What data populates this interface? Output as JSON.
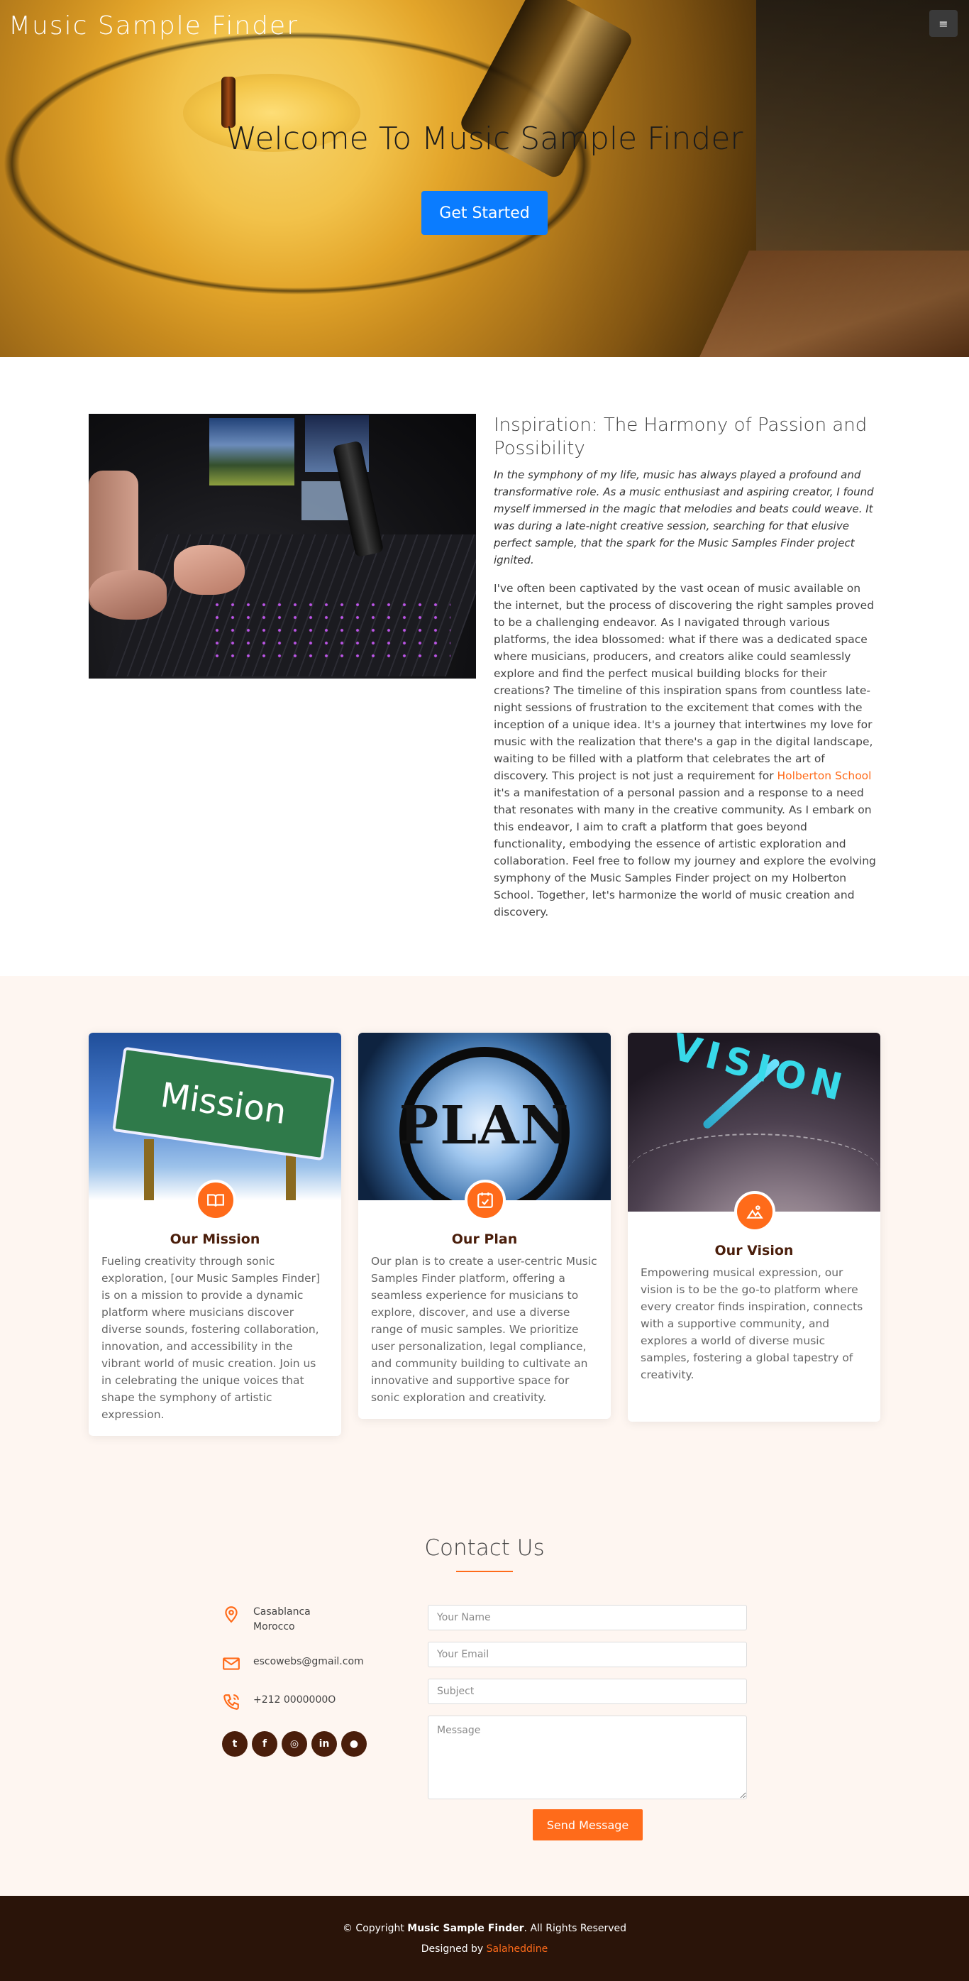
{
  "header": {
    "site_title": "Music Sample Finder",
    "menu_icon": "menu-icon"
  },
  "hero": {
    "heading": "Welcome To Music Sample Finder",
    "cta_label": "Get Started",
    "cta_color": "#0a7cff"
  },
  "about": {
    "title": "Inspiration: The Harmony of Passion and Possibility",
    "intro": "In the symphony of my life, music has always played a profound and transformative role. As a music enthusiast and aspiring creator, I found myself immersed in the magic that melodies and beats could weave. It was during a late-night creative session, searching for that elusive perfect sample, that the spark for the Music Samples Finder project ignited.",
    "body_before_link": "I've often been captivated by the vast ocean of music available on the internet, but the process of discovering the right samples proved to be a challenging endeavor. As I navigated through various platforms, the idea blossomed: what if there was a dedicated space where musicians, producers, and creators alike could seamlessly explore and find the perfect musical building blocks for their creations? The timeline of this inspiration spans from countless late-night sessions of frustration to the excitement that comes with the inception of a unique idea. It's a journey that intertwines my love for music with the realization that there's a gap in the digital landscape, waiting to be filled with a platform that celebrates the art of discovery. This project is not just a requirement for ",
    "link_text": "Holberton School",
    "body_after_link": " it's a manifestation of a personal passion and a response to a need that resonates with many in the creative community. As I embark on this endeavor, I aim to craft a platform that goes beyond functionality, embodying the essence of artistic exploration and collaboration. Feel free to follow my journey and explore the evolving symphony of the Music Samples Finder project on my Holberton School. Together, let's harmonize the world of music creation and discovery."
  },
  "cards": [
    {
      "image_text": "Mission",
      "icon": "book-icon",
      "title": "Our Mission",
      "text": "Fueling creativity through sonic exploration, [our Music Samples Finder] is on a mission to provide a dynamic platform where musicians discover diverse sounds, fostering collaboration, innovation, and accessibility in the vibrant world of music creation. Join us in celebrating the unique voices that shape the symphony of artistic expression."
    },
    {
      "image_text": "PLAN",
      "icon": "calendar-check-icon",
      "title": "Our Plan",
      "text": "Our plan is to create a user-centric Music Samples Finder platform, offering a seamless experience for musicians to explore, discover, and use a diverse range of music samples. We prioritize user personalization, legal compliance, and community building to cultivate an innovative and supportive space for sonic exploration and creativity."
    },
    {
      "image_text": "VISION",
      "icon": "image-icon",
      "title": "Our Vision",
      "text": "Empowering musical expression, our vision is to be the go-to platform where every creator finds inspiration, connects with a supportive community, and explores a world of diverse music samples, fostering a global tapestry of creativity."
    }
  ],
  "contact": {
    "title": "Contact Us",
    "address_line1": "Casablanca",
    "address_line2": "Morocco",
    "email": "escowebs@gmail.com",
    "phone": "+212 0000000O",
    "social_icons": [
      "twitter-icon",
      "facebook-icon",
      "instagram-icon",
      "linkedin-icon",
      "github-icon"
    ],
    "social_glyphs": [
      "t",
      "f",
      "◎",
      "in",
      "●"
    ],
    "form": {
      "name_placeholder": "Your Name",
      "email_placeholder": "Your Email",
      "subject_placeholder": "Subject",
      "message_placeholder": "Message",
      "send_label": "Send Message"
    },
    "accent_color": "#ff6b1a"
  },
  "footer": {
    "copyright_prefix": "© Copyright ",
    "brand": "Music Sample Finder",
    "copyright_suffix": ". All Rights Reserved",
    "designed_by": "Designed by ",
    "designer": "Salaheddine"
  }
}
